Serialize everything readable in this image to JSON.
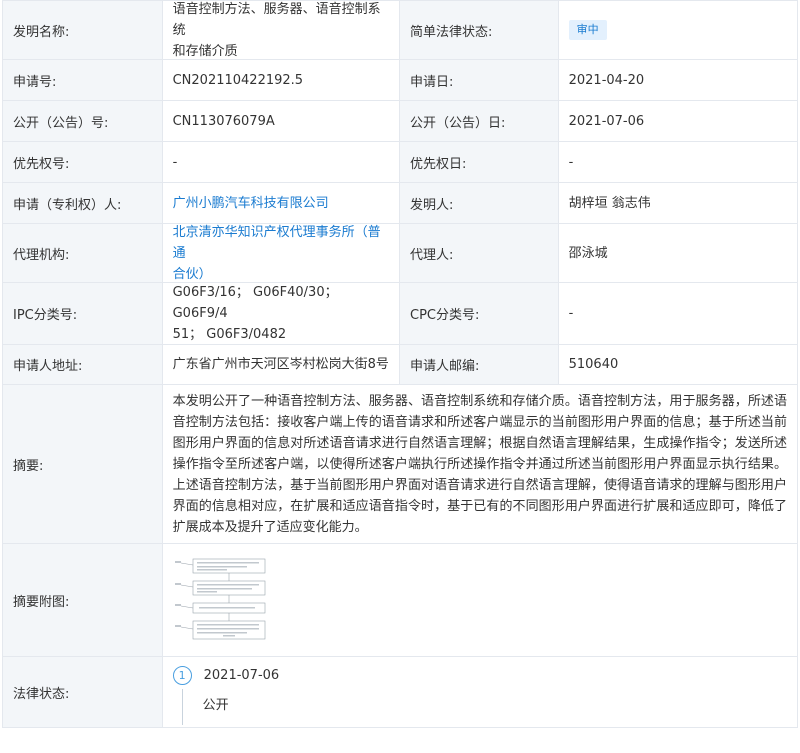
{
  "rows": {
    "title": {
      "label": "发明名称:",
      "value_line1": "语音控制方法、服务器、语音控制系统",
      "value_line2": "和存储介质",
      "label2": "简单法律状态:",
      "status": "审中"
    },
    "app_no": {
      "label": "申请号:",
      "value": "CN202110422192.5",
      "label2": "申请日:",
      "value2": "2021-04-20"
    },
    "pub_no": {
      "label": "公开（公告）号:",
      "value": "CN113076079A",
      "label2": "公开（公告）日:",
      "value2": "2021-07-06"
    },
    "priority": {
      "label": "优先权号:",
      "value": "-",
      "label2": "优先权日:",
      "value2": "-"
    },
    "applicant": {
      "label": "申请（专利权）人:",
      "value": "广州小鹏汽车科技有限公司",
      "label2": "发明人:",
      "value2": "胡梓垣 翁志伟"
    },
    "agency": {
      "label": "代理机构:",
      "value_line1": "北京清亦华知识产权代理事务所（普通",
      "value_line2": "合伙）",
      "label2": "代理人:",
      "value2": "邵泳城"
    },
    "ipc": {
      "label": "IPC分类号:",
      "value_line1": "G06F3/16； G06F40/30； G06F9/4",
      "value_line2": "51； G06F3/0482",
      "label2": "CPC分类号:",
      "value2": "-"
    },
    "address": {
      "label": "申请人地址:",
      "value": "广东省广州市天河区岑村松岗大街8号",
      "label2": "申请人邮编:",
      "value2": "510640"
    },
    "abstract": {
      "label": "摘要:",
      "value": "本发明公开了一种语音控制方法、服务器、语音控制系统和存储介质。语音控制方法，用于服务器，所述语音控制方法包括：接收客户端上传的语音请求和所述客户端显示的当前图形用户界面的信息；基于所述当前图形用户界面的信息对所述语音请求进行自然语言理解；根据自然语言理解结果，生成操作指令；发送所述操作指令至所述客户端，以使得所述客户端执行所述操作指令并通过所述当前图形用户界面显示执行结果。上述语音控制方法，基于当前图形用户界面对语音请求进行自然语言理解，使得语音请求的理解与图形用户界面的信息相对应，在扩展和适应语音指令时，基于已有的不同图形用户界面进行扩展和适应即可，降低了扩展成本及提升了适应变化能力。"
    },
    "drawing": {
      "label": "摘要附图:"
    },
    "legal": {
      "label": "法律状态:",
      "step": "1",
      "date": "2021-07-06",
      "event": "公开"
    }
  },
  "colors": {
    "link": "#1a7bd0",
    "label_bg": "#f3f6f9",
    "badge_bg": "#e3f0fd"
  }
}
